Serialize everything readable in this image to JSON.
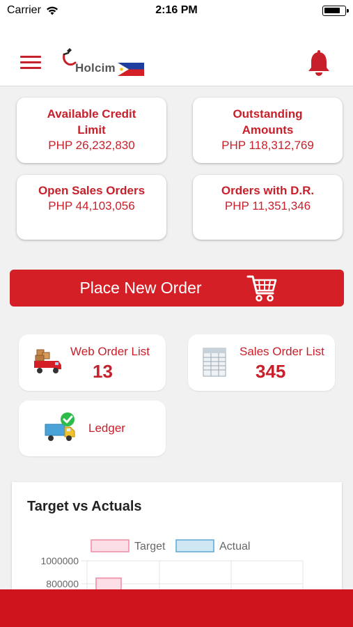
{
  "status_bar": {
    "carrier": "Carrier",
    "time": "2:16 PM",
    "battery_level": 0.8
  },
  "header": {
    "menu_icon": "hamburger-icon",
    "logo_text": "Holcim",
    "flag_icon": "philippines-flag-icon",
    "notification_icon": "bell-icon"
  },
  "summary_cards": [
    {
      "title_line1": "Available Credit",
      "title_line2": "Limit",
      "value": "PHP 26,232,830"
    },
    {
      "title_line1": "Outstanding",
      "title_line2": "Amounts",
      "value": "PHP 118,312,769"
    },
    {
      "title_line1": "Open Sales Orders",
      "title_line2": "",
      "value": "PHP 44,103,056"
    },
    {
      "title_line1": "Orders with D.R.",
      "title_line2": "",
      "value": "PHP 11,351,346"
    }
  ],
  "place_order": {
    "label": "Place New Order",
    "icon": "shopping-cart-icon"
  },
  "tiles": {
    "web_order_list": {
      "label": "Web Order List",
      "count": "13",
      "icon": "delivery-truck-icon"
    },
    "sales_order_list": {
      "label": "Sales Order List",
      "count": "345",
      "icon": "spreadsheet-icon"
    },
    "ledger": {
      "label": "Ledger",
      "icon": "truck-check-icon"
    }
  },
  "colors": {
    "brand_red": "#c8202b",
    "button_red": "#d51f26",
    "target_fill": "#fcdfe6",
    "target_stroke": "#f08aa2",
    "actual_fill": "#cfe7f3",
    "actual_stroke": "#5aa9d6"
  },
  "chart": {
    "title": "Target vs Actuals"
  },
  "chart_data": {
    "type": "bar",
    "title": "Target vs Actuals",
    "legend_position": "top",
    "series": [
      {
        "name": "Target",
        "values": [
          850000
        ]
      },
      {
        "name": "Actual",
        "values": []
      }
    ],
    "y_tick_labels": [
      "1000000",
      "800000"
    ],
    "ylim": [
      0,
      1000000
    ],
    "grid": true
  }
}
